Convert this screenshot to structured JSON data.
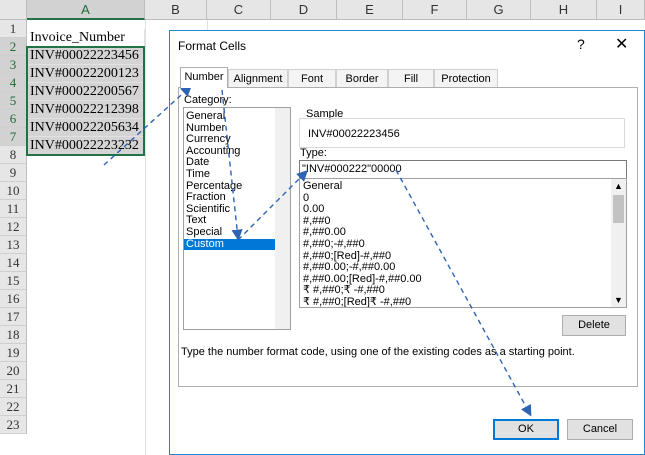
{
  "sheet": {
    "columns": [
      "A",
      "B",
      "C",
      "D",
      "E",
      "F",
      "G",
      "H",
      "I"
    ],
    "rows": [
      "1",
      "2",
      "3",
      "4",
      "5",
      "6",
      "7",
      "8",
      "9",
      "10",
      "11",
      "12",
      "13",
      "14",
      "15",
      "16",
      "17",
      "18",
      "19",
      "20",
      "21",
      "22",
      "23"
    ],
    "cells": [
      "Invoice_Number",
      "INV#00022223456",
      "INV#00022200123",
      "INV#00022200567",
      "INV#00022212398",
      "INV#00022205634",
      "INV#00022223232"
    ]
  },
  "dialog": {
    "title": "Format Cells",
    "help": "?",
    "close": "✕",
    "tabs": [
      "Number",
      "Alignment",
      "Font",
      "Border",
      "Fill",
      "Protection"
    ],
    "category_label": "Category:",
    "categories": [
      "General",
      "Number",
      "Currency",
      "Accounting",
      "Date",
      "Time",
      "Percentage",
      "Fraction",
      "Scientific",
      "Text",
      "Special",
      "Custom"
    ],
    "selected_category": "Custom",
    "sample_label": "Sample",
    "sample_value": "INV#00022223456",
    "type_label": "Type:",
    "type_value": "\"INV#000222\"00000",
    "formats": [
      "General",
      "0",
      "0.00",
      "#,##0",
      "#,##0.00",
      "#,##0;-#,##0",
      "#,##0;[Red]-#,##0",
      "#,##0.00;-#,##0.00",
      "#,##0.00;[Red]-#,##0.00",
      "₹ #,##0;₹ -#,##0",
      "₹ #,##0;[Red]₹ -#,##0"
    ],
    "delete_label": "Delete",
    "description": "Type the number format code, using one of the existing codes as a starting point.",
    "ok_label": "OK",
    "cancel_label": "Cancel"
  },
  "colors": {
    "accent": "#217346",
    "selection": "#0078d7",
    "arrow": "#2e64b3"
  }
}
